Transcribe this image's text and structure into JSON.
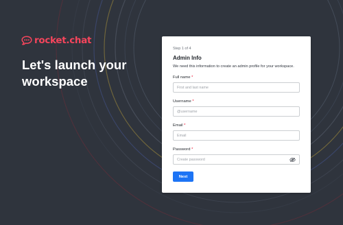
{
  "brand": {
    "name": "rocket.chat",
    "icon": "rocket-chat-logo-icon",
    "color": "#f5455c"
  },
  "hero": {
    "line1": "Let's launch your",
    "line2": "workspace"
  },
  "form": {
    "step": "Step 1 of 4",
    "title": "Admin Info",
    "description": "We need this information to create an admin profile for your workspace.",
    "required_marker": "*",
    "fields": {
      "full_name": {
        "label": "Full name",
        "placeholder": "First and last name",
        "value": ""
      },
      "username": {
        "label": "Username",
        "placeholder": "@username",
        "value": ""
      },
      "email": {
        "label": "Email",
        "placeholder": "Email",
        "value": ""
      },
      "password": {
        "label": "Password",
        "placeholder": "Create password",
        "value": "",
        "icon": "eye-icon"
      }
    },
    "next_label": "Next"
  },
  "colors": {
    "background": "#2f343d",
    "primary": "#1d74f5",
    "required": "#ec0d2a"
  }
}
